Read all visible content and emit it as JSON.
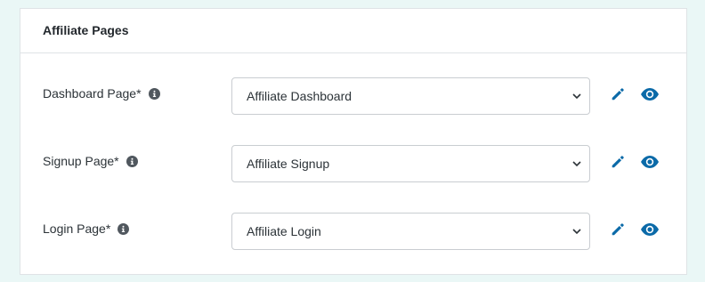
{
  "panel": {
    "title": "Affiliate Pages"
  },
  "rows": [
    {
      "label": "Dashboard Page*",
      "selected": "Affiliate Dashboard"
    },
    {
      "label": "Signup Page*",
      "selected": "Affiliate Signup"
    },
    {
      "label": "Login Page*",
      "selected": "Affiliate Login"
    }
  ],
  "icons": {
    "info": "info-circle-icon",
    "dropdown": "chevron-down-icon",
    "edit": "pencil-icon",
    "view": "eye-icon"
  },
  "colors": {
    "accent": "#0b6aa8",
    "background": "#eaf7f6",
    "info": "#50575e"
  }
}
